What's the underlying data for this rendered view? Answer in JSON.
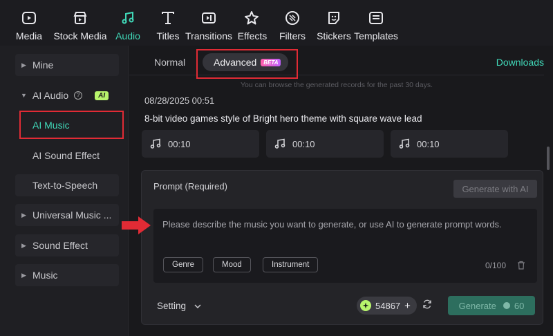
{
  "toolbar": {
    "items": [
      {
        "label": "Media",
        "icon": "media-icon"
      },
      {
        "label": "Stock Media",
        "icon": "stock-media-icon"
      },
      {
        "label": "Audio",
        "icon": "audio-icon"
      },
      {
        "label": "Titles",
        "icon": "titles-icon"
      },
      {
        "label": "Transitions",
        "icon": "transitions-icon"
      },
      {
        "label": "Effects",
        "icon": "effects-icon"
      },
      {
        "label": "Filters",
        "icon": "filters-icon"
      },
      {
        "label": "Stickers",
        "icon": "stickers-icon"
      },
      {
        "label": "Templates",
        "icon": "templates-icon"
      }
    ],
    "active": "Audio"
  },
  "sidebar": {
    "mine": "Mine",
    "ai_audio": "AI Audio",
    "ai_badge": "AI",
    "ai_music": "AI Music",
    "ai_sound_effect": "AI Sound Effect",
    "text_to_speech": "Text-to-Speech",
    "universal_music": "Universal Music ...",
    "sound_effect": "Sound Effect",
    "music": "Music"
  },
  "main": {
    "tab_normal": "Normal",
    "tab_advanced": "Advanced",
    "beta": "BETA",
    "downloads": "Downloads",
    "records_note": "You can browse the generated records for the past 30 days.",
    "record": {
      "date": "08/28/2025 00:51",
      "title": "8-bit video games style of Bright hero theme with square wave lead",
      "tracks": [
        "00:10",
        "00:10",
        "00:10"
      ]
    },
    "prompt": {
      "label": "Prompt (Required)",
      "generate_with_ai": "Generate with AI",
      "placeholder": "Please describe the music you want to generate, or use AI to generate prompt words.",
      "chips": [
        "Genre",
        "Mood",
        "Instrument"
      ],
      "counter": "0/100"
    },
    "setting": "Setting",
    "credits": "54867",
    "generate": "Generate",
    "generate_cost": "60"
  },
  "colors": {
    "accent": "#40d8b8",
    "annotation_red": "#e12b35",
    "ai_badge": "#b8f56c"
  }
}
